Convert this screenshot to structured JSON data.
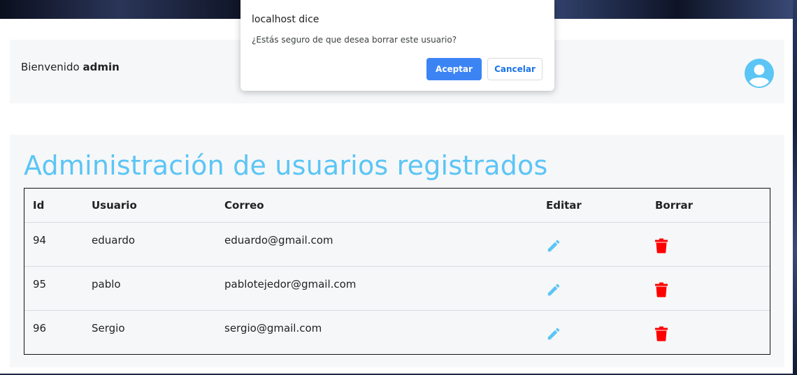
{
  "header": {
    "welcome_prefix": "Bienvenido",
    "username": "admin",
    "avatar_icon": "user-circle-icon"
  },
  "main": {
    "title": "Administración de usuarios registrados",
    "columns": [
      "Id",
      "Usuario",
      "Correo",
      "Editar",
      "Borrar"
    ],
    "rows": [
      {
        "id": "94",
        "usuario": "eduardo",
        "correo": "eduardo@gmail.com"
      },
      {
        "id": "95",
        "usuario": "pablo",
        "correo": "pablotejedor@gmail.com"
      },
      {
        "id": "96",
        "usuario": "Sergio",
        "correo": "sergio@gmail.com"
      }
    ],
    "edit_icon": "pencil-icon",
    "delete_icon": "trash-icon"
  },
  "dialog": {
    "title": "localhost dice",
    "message": "¿Estás seguro de que desea borrar este usuario?",
    "ok_label": "Aceptar",
    "cancel_label": "Cancelar"
  },
  "colors": {
    "accent": "#5bc5f5",
    "delete": "#ff0000",
    "primary_button": "#3c84f4"
  }
}
